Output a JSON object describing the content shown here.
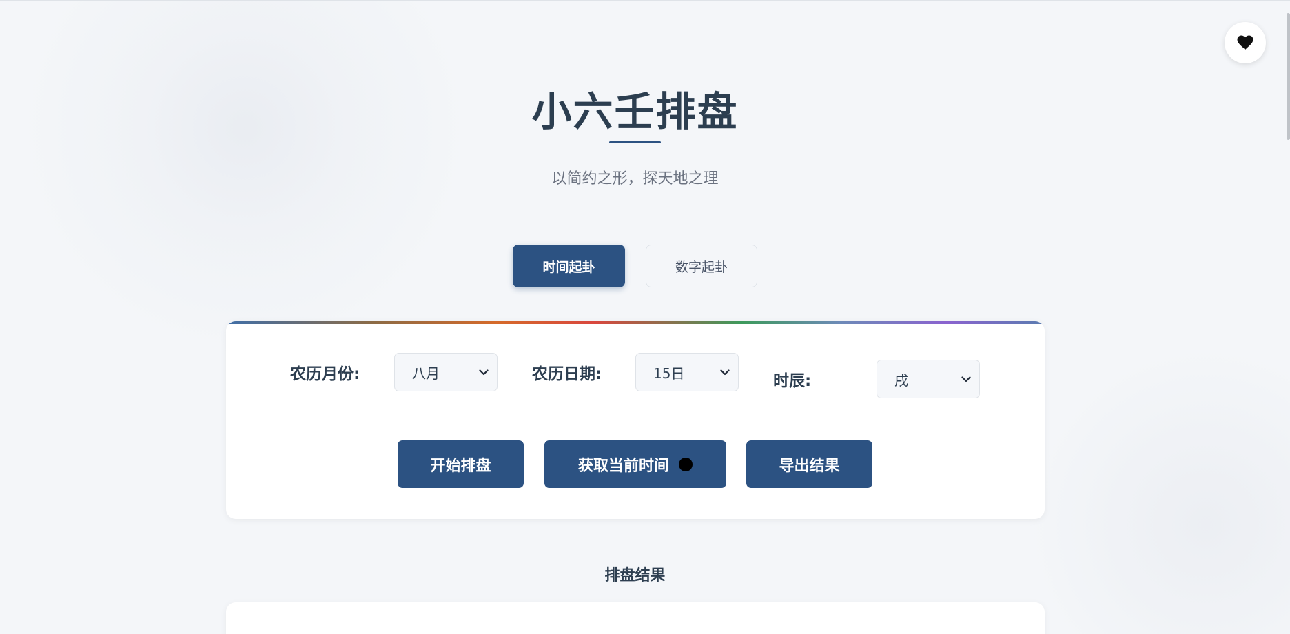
{
  "header": {
    "title": "小六壬排盘",
    "subtitle": "以简约之形，探天地之理"
  },
  "tabs": [
    {
      "label": "时间起卦",
      "active": true
    },
    {
      "label": "数字起卦",
      "active": false
    }
  ],
  "form": {
    "month_label": "农历月份:",
    "month_value": "八月",
    "day_label": "农历日期:",
    "day_value": "15日",
    "hour_label": "时辰:",
    "hour_value": "戌"
  },
  "actions": {
    "start_label": "开始排盘",
    "now_label": "获取当前时间",
    "export_label": "导出结果"
  },
  "results": {
    "heading": "排盘结果"
  },
  "icons": {
    "favorite": "heart-icon",
    "dropdown": "chevron-down-icon"
  },
  "colors": {
    "primary": "#2c5282",
    "text": "#2d3e50",
    "muted": "#6b7280",
    "background": "#f4f6f9"
  }
}
